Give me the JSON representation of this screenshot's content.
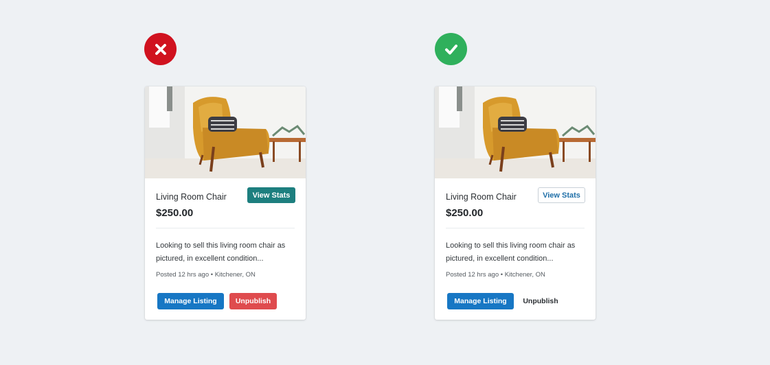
{
  "badges": {
    "bad": {
      "icon": "x-mark-icon",
      "color": "#d0121f"
    },
    "good": {
      "icon": "checkmark-icon",
      "color": "#2fb05c"
    }
  },
  "cards": [
    {
      "variant": "bad",
      "title": "Living Room Chair",
      "price": "$250.00",
      "view_stats_label": "View Stats",
      "description": "Looking to sell this living room chair as pictured, in excellent condition...",
      "meta": "Posted 12 hrs ago • Kitchener, ON",
      "manage_label": "Manage Listing",
      "unpublish_label": "Unpublish",
      "colors": {
        "view_stats": "#1d7f7f",
        "manage": "#1777c4",
        "unpublish": "#df4b4e"
      }
    },
    {
      "variant": "good",
      "title": "Living Room Chair",
      "price": "$250.00",
      "view_stats_label": "View Stats",
      "description": "Looking to sell this living room chair as pictured, in excellent condition...",
      "meta": "Posted 12 hrs ago • Kitchener, ON",
      "manage_label": "Manage Listing",
      "unpublish_label": "Unpublish",
      "colors": {
        "view_stats": "#1f6fa8",
        "manage": "#1777c4",
        "unpublish": "#2b2f33"
      }
    }
  ]
}
